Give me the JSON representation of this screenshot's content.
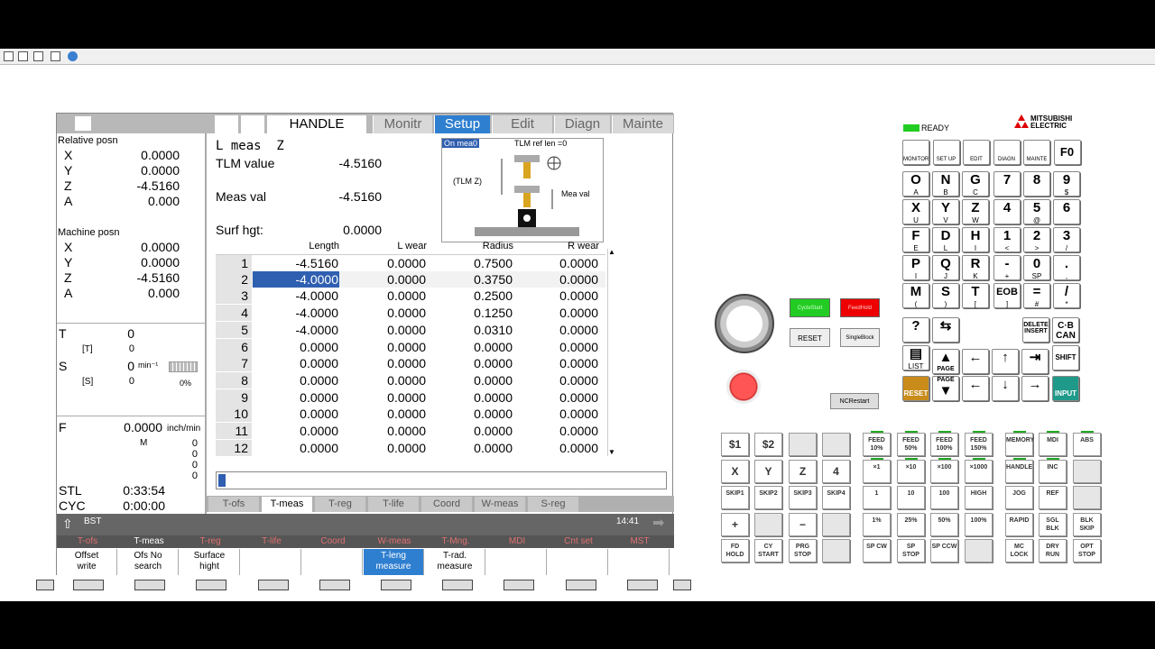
{
  "status": {
    "ready": "READY",
    "brand": "MITSUBISHI ELECTRIC"
  },
  "header": {
    "mode": "HANDLE",
    "tabs": [
      "Monitr",
      "Setup",
      "Edit",
      "Diagn",
      "Mainte"
    ],
    "active": "Setup"
  },
  "left": {
    "relative_title": "Relative posn",
    "relative": [
      {
        "axis": "X",
        "value": "0.0000"
      },
      {
        "axis": "Y",
        "value": "0.0000"
      },
      {
        "axis": "Z",
        "value": "-4.5160"
      },
      {
        "axis": "A",
        "value": "0.000"
      }
    ],
    "machine_title": "Machine posn",
    "machine": [
      {
        "axis": "X",
        "value": "0.0000"
      },
      {
        "axis": "Y",
        "value": "0.0000"
      },
      {
        "axis": "Z",
        "value": "-4.5160"
      },
      {
        "axis": "A",
        "value": "0.000"
      }
    ],
    "t_label": "T",
    "t_value": "0",
    "tb_label": "[T]",
    "tb_value": "0",
    "s_label": "S",
    "s_value": "0",
    "s_unit": "min⁻¹",
    "sb_label": "[S]",
    "sb_value": "0",
    "s_pct": "0%",
    "f_label": "F",
    "f_value": "0.0000",
    "f_unit": "inch/min",
    "m_label": "M",
    "m_values": [
      "0",
      "0",
      "0",
      "0"
    ],
    "stl_label": "STL",
    "stl_value": "0:33:54",
    "cyc_label": "CYC",
    "cyc_value": "0:00:00"
  },
  "meas": {
    "l_meas": "L meas  Z",
    "tlm_label": "TLM value",
    "tlm_value": "-4.5160",
    "meas_label": "Meas val",
    "meas_value": "-4.5160",
    "surf_label": "Surf hgt:",
    "surf_value": "0.0000",
    "diag_onmea": "On mea0",
    "diag_ref": "TLM ref len =0",
    "diag_tlmz": "(TLM Z)",
    "diag_measval": "Mea val"
  },
  "table": {
    "headers": [
      "Length",
      "L wear",
      "Radius",
      "R wear"
    ],
    "rows": [
      [
        "1",
        "-4.5160",
        "0.0000",
        "0.7500",
        "0.0000"
      ],
      [
        "2",
        "-4.0000",
        "0.0000",
        "0.3750",
        "0.0000"
      ],
      [
        "3",
        "-4.0000",
        "0.0000",
        "0.2500",
        "0.0000"
      ],
      [
        "4",
        "-4.0000",
        "0.0000",
        "0.1250",
        "0.0000"
      ],
      [
        "5",
        "-4.0000",
        "0.0000",
        "0.0310",
        "0.0000"
      ],
      [
        "6",
        "0.0000",
        "0.0000",
        "0.0000",
        "0.0000"
      ],
      [
        "7",
        "0.0000",
        "0.0000",
        "0.0000",
        "0.0000"
      ],
      [
        "8",
        "0.0000",
        "0.0000",
        "0.0000",
        "0.0000"
      ],
      [
        "9",
        "0.0000",
        "0.0000",
        "0.0000",
        "0.0000"
      ],
      [
        "10",
        "0.0000",
        "0.0000",
        "0.0000",
        "0.0000"
      ],
      [
        "11",
        "0.0000",
        "0.0000",
        "0.0000",
        "0.0000"
      ],
      [
        "12",
        "0.0000",
        "0.0000",
        "0.0000",
        "0.0000"
      ]
    ]
  },
  "bottom_tabs": [
    "T-ofs",
    "T-meas",
    "T-reg",
    "T-life",
    "Coord",
    "W-meas",
    "S-reg"
  ],
  "bst": {
    "label": "BST",
    "time": "14:41"
  },
  "fkeys": [
    "T-ofs",
    "T-meas",
    "T-reg",
    "T-life",
    "Coord",
    "W-meas",
    "T-Mng.",
    "MDI",
    "Cnt set",
    "MST"
  ],
  "softkeys": [
    "Offset\nwrite",
    "Ofs No\nsearch",
    "Surface\nhight",
    "",
    "",
    "T-leng\nmeasure",
    "T-rad.\nmeasure",
    "",
    "",
    ""
  ],
  "op": {
    "cyclestart": "CycleStart",
    "feedhold": "FeedHold",
    "reset": "RESET",
    "singleblock": "SingleBlock",
    "ncrestart": "NCRestart"
  },
  "func_keys": [
    "MONITOR",
    "SET UP",
    "EDIT",
    "DIAGN",
    "MAINTE",
    "F0"
  ],
  "keypad": [
    [
      [
        "O",
        "A"
      ],
      [
        "N",
        "B"
      ],
      [
        "G",
        "C"
      ],
      [
        "7",
        ""
      ],
      [
        "8",
        ""
      ],
      [
        "9",
        "$"
      ]
    ],
    [
      [
        "X",
        "U"
      ],
      [
        "Y",
        "V"
      ],
      [
        "Z",
        "W"
      ],
      [
        "4",
        ""
      ],
      [
        "5",
        "@"
      ],
      [
        "6",
        ""
      ]
    ],
    [
      [
        "F",
        "E"
      ],
      [
        "D",
        "L"
      ],
      [
        "H",
        "I"
      ],
      [
        "1",
        "<"
      ],
      [
        "2",
        ">"
      ],
      [
        "3",
        "/"
      ]
    ],
    [
      [
        "P",
        "I"
      ],
      [
        "Q",
        "J"
      ],
      [
        "R",
        "K"
      ],
      [
        "-",
        "+"
      ],
      [
        "0",
        "SP"
      ],
      [
        ".",
        ","
      ]
    ],
    [
      [
        "M",
        "("
      ],
      [
        "S",
        ")"
      ],
      [
        "T",
        "["
      ],
      [
        "EOB",
        "]"
      ],
      [
        "=",
        "#"
      ],
      [
        "/",
        "*"
      ]
    ]
  ],
  "edit_keys": [
    "DELETE INSERT",
    "C·B CAN",
    "SHIFT",
    "PAGE",
    "PAGE",
    "INPUT",
    "RESET",
    "LIST"
  ],
  "grid": [
    [
      "$1",
      "$2",
      "",
      "",
      "FEED 10%",
      "FEED 50%",
      "FEED 100%",
      "FEED 150%",
      "MEMORY",
      "MDI",
      "ABS"
    ],
    [
      "X",
      "Y",
      "Z",
      "4",
      "×1",
      "×10",
      "×100",
      "×1000",
      "HANDLE",
      "INC",
      ""
    ],
    [
      "SKIP1",
      "SKIP2",
      "SKIP3",
      "SKIP4",
      "1",
      "10",
      "100",
      "HIGH",
      "JOG",
      "REF",
      ""
    ],
    [
      "+",
      "",
      "−",
      "",
      "1%",
      "25%",
      "50%",
      "100%",
      "RAPID",
      "SGL BLK",
      "BLK SKIP"
    ],
    [
      "FD HOLD",
      "CY START",
      "PRG STOP",
      "",
      "SP CW",
      "SP STOP",
      "SP CCW",
      "",
      "MC LOCK",
      "DRY RUN",
      "OPT STOP"
    ]
  ]
}
